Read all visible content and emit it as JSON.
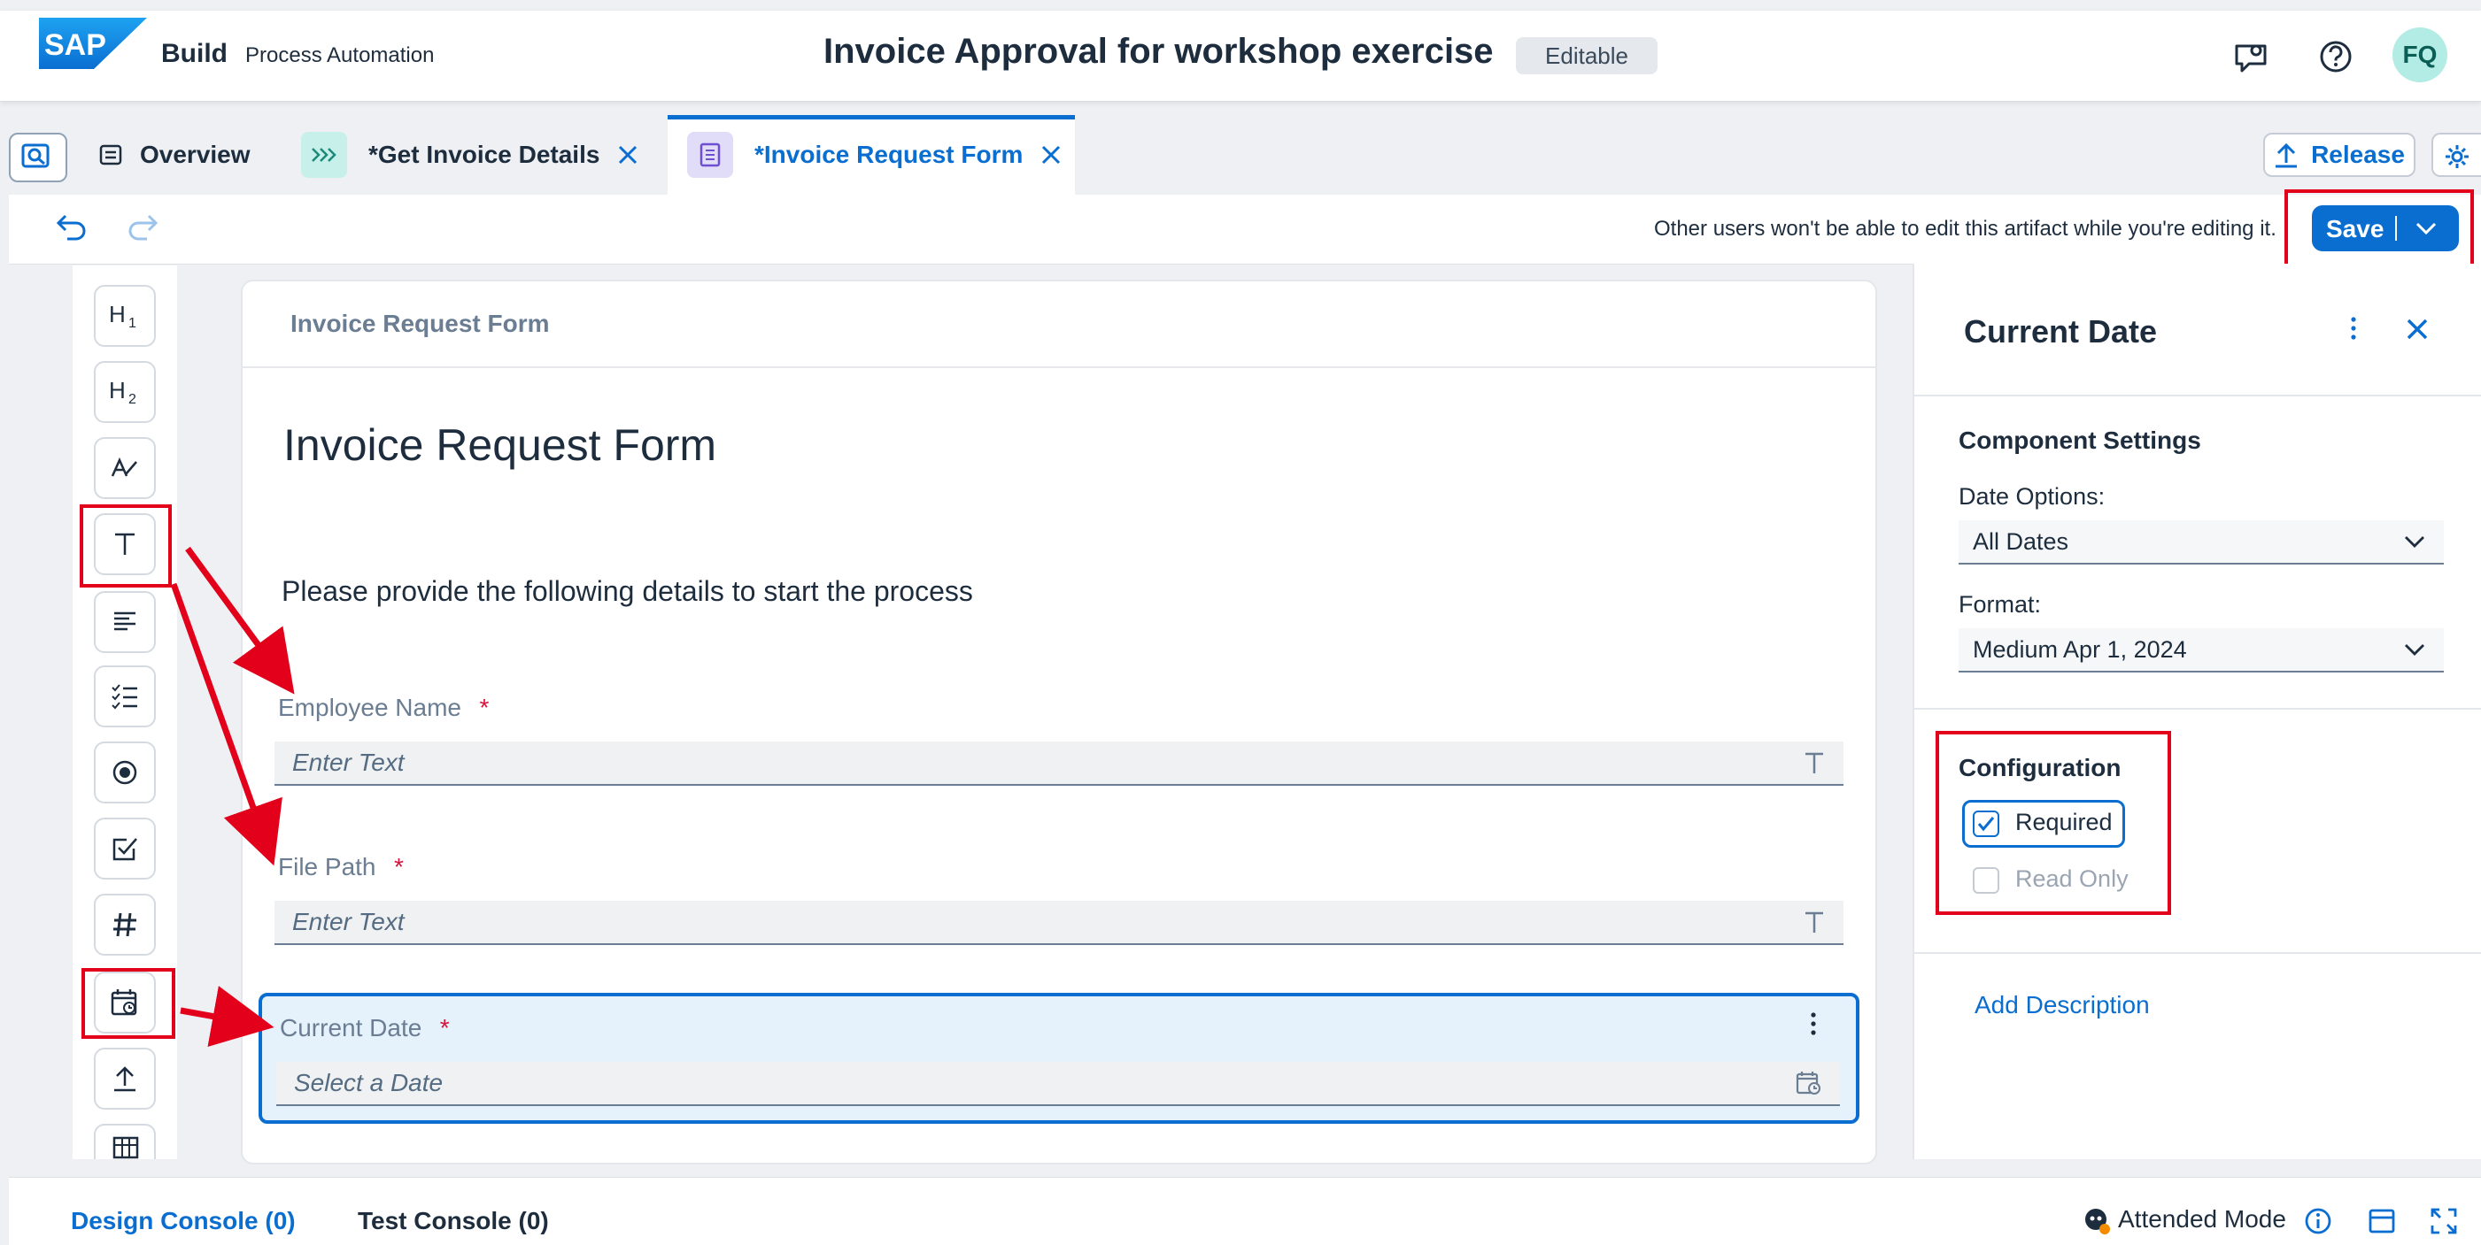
{
  "shell": {
    "logo_text": "SAP",
    "product_name": "Build",
    "product_sub": "Process Automation",
    "process_title": "Invoice Approval for workshop exercise",
    "status_badge": "Editable",
    "avatar_initials": "FQ",
    "icons": [
      "feedback-icon",
      "help-icon"
    ]
  },
  "tabs": [
    {
      "label": "Overview",
      "icon": "overview-icon"
    },
    {
      "label": "*Get Invoice Details",
      "icon": "automation-icon",
      "closable": true
    },
    {
      "label": "*Invoice Request Form",
      "icon": "form-icon",
      "closable": true,
      "active": true
    }
  ],
  "tab_actions": {
    "release_label": "Release"
  },
  "toolbar": {
    "message": "Other users won't be able to edit this artifact while you're editing it.",
    "save_label": "Save"
  },
  "palette": [
    "heading-1-icon",
    "heading-2-icon",
    "paragraph-icon",
    "text-field-icon",
    "text-area-icon",
    "checklist-icon",
    "radio-icon",
    "checkbox-icon",
    "number-icon",
    "date-icon",
    "upload-icon",
    "table-icon"
  ],
  "canvas": {
    "header_title": "Invoice Request Form",
    "heading": "Invoice Request Form",
    "paragraph": "Please provide the following details to start the process",
    "fields": [
      {
        "label": "Employee Name",
        "required_mark": "*",
        "placeholder": "Enter Text"
      },
      {
        "label": "File Path",
        "required_mark": "*",
        "placeholder": "Enter Text"
      },
      {
        "label": "Current Date",
        "required_mark": "*",
        "placeholder": "Select a Date"
      }
    ]
  },
  "right_panel": {
    "title": "Current Date",
    "component_settings_label": "Component Settings",
    "date_options_label": "Date Options:",
    "date_options_value": "All Dates",
    "format_label": "Format:",
    "format_value": "Medium Apr 1, 2024",
    "configuration_label": "Configuration",
    "required_label": "Required",
    "required_checked": true,
    "read_only_label": "Read Only",
    "read_only_checked": false,
    "add_description_label": "Add Description"
  },
  "bottom": {
    "design_console": "Design Console (0)",
    "test_console": "Test Console (0)",
    "attended_mode": "Attended Mode"
  },
  "colors": {
    "accent": "#0a6ed1",
    "annotation": "#e3001b",
    "required": "#d8123a"
  }
}
